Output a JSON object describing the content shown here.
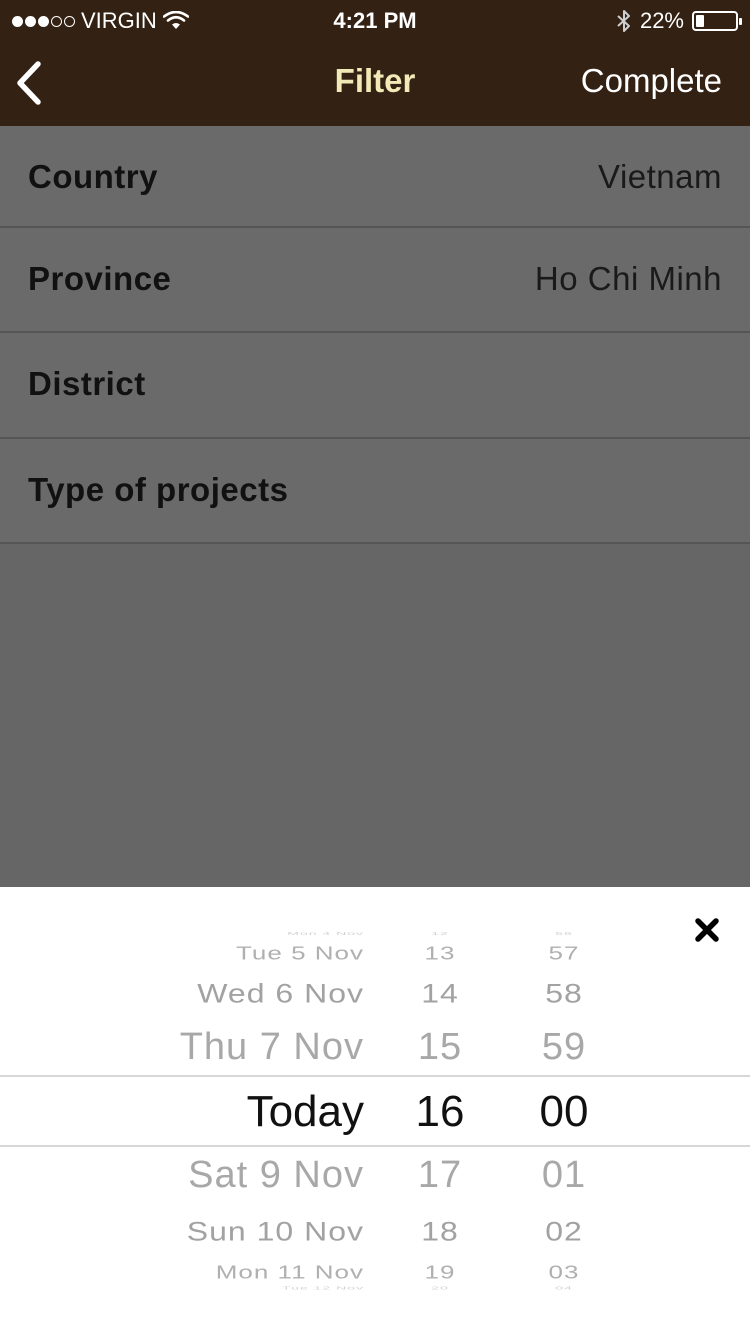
{
  "status_bar": {
    "carrier": "VIRGIN",
    "time": "4:21 PM",
    "battery": "22%",
    "battery_level": 0.22,
    "signal_bars": 3
  },
  "navbar": {
    "title": "Filter",
    "complete_label": "Complete",
    "back_icon": "chevron-left-icon",
    "colors": {
      "background": "#332114",
      "title": "#f2eab6",
      "action": "#ffffff"
    }
  },
  "filters": [
    {
      "label": "Country",
      "value": "Vietnam"
    },
    {
      "label": "Province",
      "value": "Ho Chi Minh"
    },
    {
      "label": "District",
      "value": ""
    },
    {
      "label": "Type of projects",
      "value": ""
    }
  ],
  "picker": {
    "close_icon": "close-icon",
    "dates": [
      "Mon 4 Nov",
      "Tue 5 Nov",
      "Wed 6 Nov",
      "Thu 7 Nov",
      "Today",
      "Sat 9 Nov",
      "Sun 10 Nov",
      "Mon 11 Nov",
      "Tue 12 Nov"
    ],
    "hours": [
      "12",
      "13",
      "14",
      "15",
      "16",
      "17",
      "18",
      "19",
      "20"
    ],
    "minutes": [
      "56",
      "57",
      "58",
      "59",
      "00",
      "01",
      "02",
      "03",
      "04"
    ],
    "selected": {
      "date": "Today",
      "hour": "16",
      "minute": "00"
    }
  }
}
